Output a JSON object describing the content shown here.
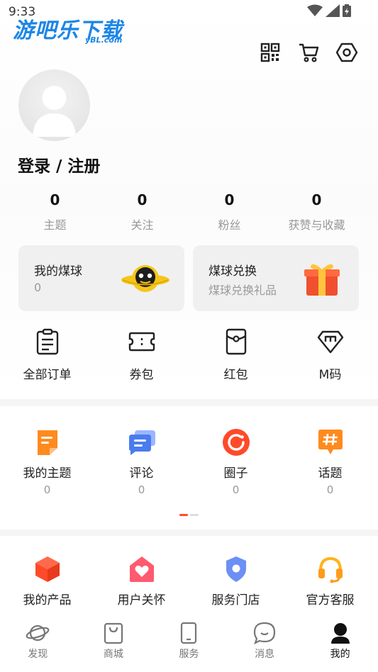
{
  "status": {
    "time": "9:33"
  },
  "watermark": {
    "main": "游吧乐下载",
    "sub": "yBL.com"
  },
  "profile": {
    "login_label": "登录 / 注册"
  },
  "stats": [
    {
      "value": "0",
      "label": "主题"
    },
    {
      "value": "0",
      "label": "关注"
    },
    {
      "value": "0",
      "label": "粉丝"
    },
    {
      "value": "0",
      "label": "获赞与收藏"
    }
  ],
  "cards": [
    {
      "title": "我的煤球",
      "subtitle": "0"
    },
    {
      "title": "煤球兑换",
      "subtitle": "煤球兑换礼品"
    }
  ],
  "quick": [
    {
      "label": "全部订单",
      "icon": "clipboard-icon"
    },
    {
      "label": "券包",
      "icon": "ticket-icon"
    },
    {
      "label": "红包",
      "icon": "red-envelope-icon"
    },
    {
      "label": "M码",
      "icon": "m-code-icon"
    }
  ],
  "content": [
    {
      "label": "我的主题",
      "count": "0",
      "icon": "topic-icon"
    },
    {
      "label": "评论",
      "count": "0",
      "icon": "comment-icon"
    },
    {
      "label": "圈子",
      "count": "0",
      "icon": "circle-icon"
    },
    {
      "label": "话题",
      "count": "0",
      "icon": "hashtag-icon"
    }
  ],
  "services": [
    {
      "label": "我的产品",
      "icon": "product-cube-icon"
    },
    {
      "label": "用户关怀",
      "icon": "care-heart-icon"
    },
    {
      "label": "服务门店",
      "icon": "store-location-icon"
    },
    {
      "label": "官方客服",
      "icon": "headset-icon"
    }
  ],
  "tabs": [
    {
      "label": "发现",
      "icon": "planet-icon",
      "active": false
    },
    {
      "label": "商城",
      "icon": "shop-bag-icon",
      "active": false
    },
    {
      "label": "服务",
      "icon": "phone-icon",
      "active": false
    },
    {
      "label": "消息",
      "icon": "message-icon",
      "active": false
    },
    {
      "label": "我的",
      "icon": "user-icon",
      "active": true
    }
  ],
  "colors": {
    "accent": "#ff4a2a",
    "orange": "#ff8a1e",
    "blue": "#4a7cf0",
    "active_text": "#111111"
  }
}
